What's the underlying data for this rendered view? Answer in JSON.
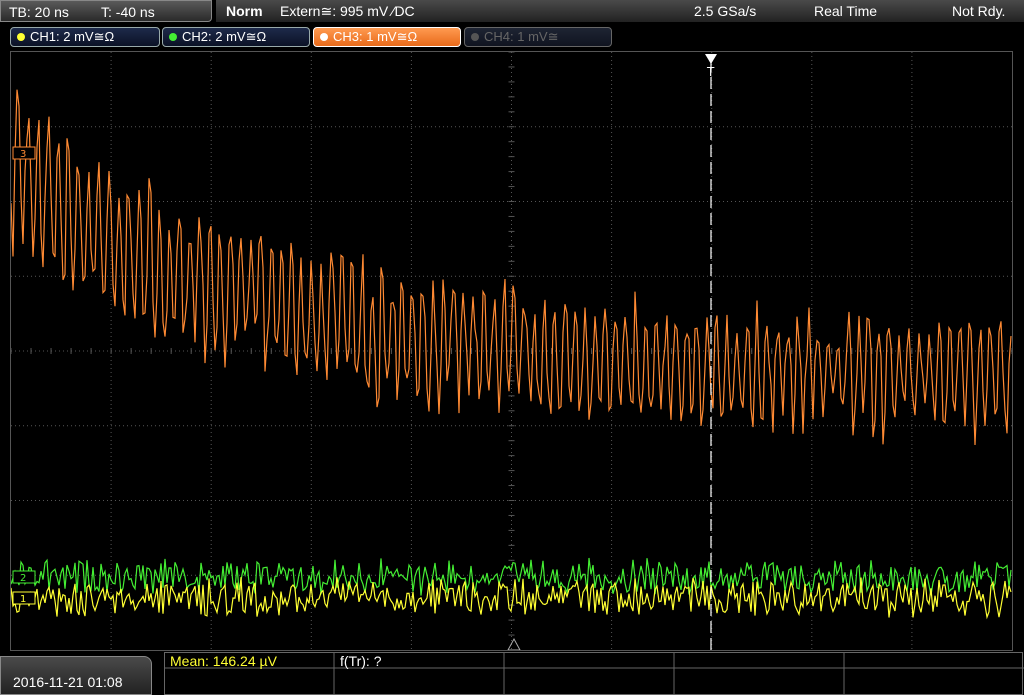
{
  "status_bar": {
    "timebase": "TB: 20 ns",
    "trigger_time": "T: -40 ns",
    "trigger_mode": "Norm",
    "trigger_source": "Extern≅: 995 mV ⁄DC",
    "sample_rate": "2.5 GSa/s",
    "acquisition_mode": "Real Time",
    "state": "Not Rdy."
  },
  "channels": [
    {
      "label": "CH1: 2 mV≅Ω",
      "color": "#ffff33",
      "state": "on"
    },
    {
      "label": "CH2: 2 mV≅Ω",
      "color": "#44ee33",
      "state": "on"
    },
    {
      "label": "CH3: 1 mV≅Ω",
      "color": "#ff8a33",
      "state": "active"
    },
    {
      "label": "CH4: 1 mV≅",
      "color": "#666666",
      "state": "off"
    }
  ],
  "traces": {
    "ch3_marker": "3",
    "ch2_marker": "2",
    "ch1_marker": "1",
    "trigger_marker": "T"
  },
  "footer": {
    "datetime": "2016-11-21 01:08",
    "measurement_mean": "Mean: 146.24 µV",
    "measurement_freq": "f(Tr): ?"
  },
  "colors": {
    "ch1": "#ffff33",
    "ch2": "#44ee33",
    "ch3": "#ff8a33",
    "grid": "#555555",
    "trigger_line": "#ffffff"
  }
}
